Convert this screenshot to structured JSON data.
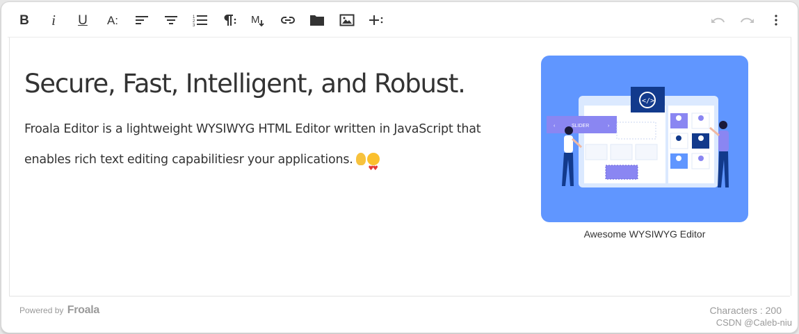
{
  "toolbar": {
    "buttons": [
      {
        "name": "bold-button",
        "label": "B",
        "icon": "bold-icon"
      },
      {
        "name": "italic-button",
        "label": "i",
        "icon": "italic-icon"
      },
      {
        "name": "underline-button",
        "label": "U",
        "icon": "underline-icon"
      },
      {
        "name": "text-format-button",
        "label": "A:",
        "icon": "text-size-icon"
      },
      {
        "name": "align-left-button",
        "icon": "align-left-icon"
      },
      {
        "name": "align-center-button",
        "icon": "align-center-icon"
      },
      {
        "name": "ordered-list-button",
        "icon": "ordered-list-icon"
      },
      {
        "name": "paragraph-format-button",
        "icon": "paragraph-icon"
      },
      {
        "name": "markdown-button",
        "icon": "markdown-icon"
      },
      {
        "name": "insert-link-button",
        "icon": "link-icon"
      },
      {
        "name": "insert-file-button",
        "icon": "folder-icon"
      },
      {
        "name": "insert-image-button",
        "icon": "image-icon"
      },
      {
        "name": "more-insert-button",
        "icon": "plus-more-icon"
      }
    ],
    "right": [
      {
        "name": "undo-button",
        "icon": "undo-icon",
        "disabled": true
      },
      {
        "name": "redo-button",
        "icon": "redo-icon",
        "disabled": true
      },
      {
        "name": "more-options-button",
        "icon": "kebab-menu-icon",
        "disabled": false
      }
    ]
  },
  "content": {
    "heading": "Secure, Fast, Intelligent, and Robust.",
    "paragraph": "Froala Editor is a lightweight WYSIWYG HTML Editor written in JavaScript that enables rich text editing capabilitiesr your applications.",
    "emojis": [
      "ok-hand-emoji",
      "heart-eyes-emoji"
    ],
    "image": {
      "caption": "Awesome WYSIWYG Editor",
      "slider_label": "SLIDER",
      "background_color": "#6096ff"
    }
  },
  "footer": {
    "powered_by": "Powered by",
    "brand": "Froala",
    "char_count": "Characters : 200",
    "watermark": "CSDN @Caleb-niu"
  },
  "colors": {
    "text": "#333333",
    "muted": "#999999",
    "image_bg": "#6096ff"
  }
}
